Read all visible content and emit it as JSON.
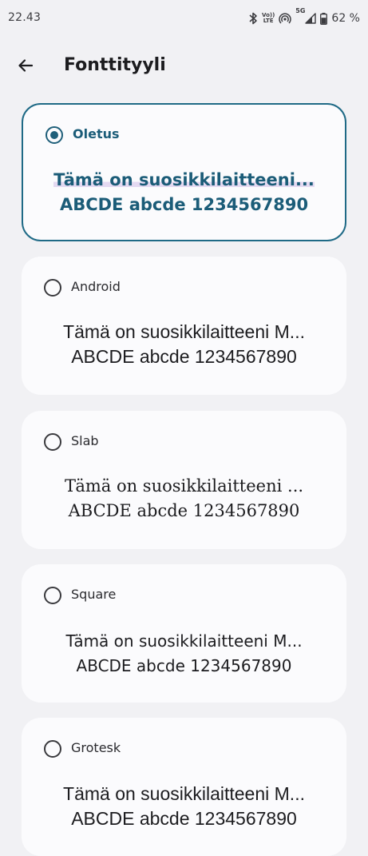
{
  "status_bar": {
    "time": "22.43",
    "network_label_top": "Vo))",
    "network_label_bottom": "LTE",
    "network_5g": "5G",
    "battery_percent": "62 %"
  },
  "header": {
    "title": "Fonttityyli"
  },
  "options": [
    {
      "label": "Oletus",
      "selected": true,
      "preview_line1": "Tämä on suosikkilaitteeni...",
      "preview_line2": "ABCDE abcde 1234567890"
    },
    {
      "label": "Android",
      "selected": false,
      "preview_line1": "Tämä on suosikkilaitteeni M...",
      "preview_line2": "ABCDE abcde 1234567890"
    },
    {
      "label": "Slab",
      "selected": false,
      "preview_line1": "Tämä on suosikkilaitteeni ...",
      "preview_line2": "ABCDE abcde 1234567890"
    },
    {
      "label": "Square",
      "selected": false,
      "preview_line1": "Tämä on suosikkilaitteeni M...",
      "preview_line2": "ABCDE abcde 1234567890"
    },
    {
      "label": "Grotesk",
      "selected": false,
      "preview_line1": "Tämä on suosikkilaitteeni M...",
      "preview_line2": "ABCDE abcde 1234567890"
    }
  ],
  "colors": {
    "accent": "#1f6a86",
    "background": "#f1f1f4",
    "card": "#fbfbfd",
    "highlight": "#e4d9f1"
  },
  "icons": {
    "back": "arrow-left-icon",
    "bluetooth": "bluetooth-icon",
    "hotspot": "hotspot-icon",
    "signal": "cell-signal-icon",
    "battery": "battery-icon"
  }
}
